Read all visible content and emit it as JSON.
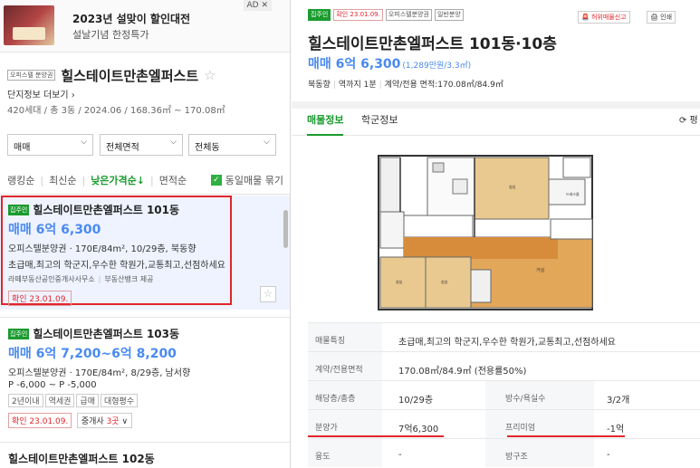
{
  "ad": {
    "badge": "AD ✕",
    "title": "2023년 설맞이 할인대전",
    "subtitle": "설날기념 한정특가"
  },
  "complex": {
    "type_tag": "오피스텔 분양권",
    "name": "힐스테이트만촌엘퍼스트",
    "more_link": "단지정보 더보기",
    "info": "420세대 / 총 3동 / 2024.06 / 168.36㎡ ~ 170.08㎡"
  },
  "filters": [
    {
      "label": "매매"
    },
    {
      "label": "전체면적"
    },
    {
      "label": "전체동"
    }
  ],
  "sort": {
    "items": [
      "랭킹순",
      "최신순",
      "낮은가격순↓",
      "면적순"
    ],
    "active_index": 2,
    "checkbox_label": "동일매물 묶기"
  },
  "listings": [
    {
      "tag": "집주인",
      "title": "힐스테이트만촌엘퍼스트 101동",
      "price": "매매 6억 6,300",
      "spec": "오피스텔분양권 · 170E/84m², 10/29층, 북동향",
      "desc": "초급매,최고의 학군지,우수한 학원가,교통최고,선점하세요",
      "source_agent": "라떼부동산공인중개사사무소",
      "source_provider": "부동산뱅크 제공",
      "confirm": "확인 23.01.09."
    },
    {
      "tag": "집주인",
      "title": "힐스테이트만촌엘퍼스트 103동",
      "price": "매매 6억 7,200~6억 8,200",
      "spec": "오피스텔분양권 · 170E/84m², 8/29층, 남서향",
      "premium": "P -6,000 ~ P -5,000",
      "chips": [
        "2년이내",
        "역세권",
        "급매",
        "대형평수"
      ],
      "confirm": "확인 23.01.09.",
      "broker_prefix": "중개사 ",
      "broker_count": "3곳",
      "broker_suffix": "∨"
    },
    {
      "title": "힐스테이트만촌엘퍼스트 102동"
    }
  ],
  "detail": {
    "tags": [
      "집주인",
      "확인 23.01.09.",
      "오피스텔분양권",
      "일반분양"
    ],
    "report": "허위매물신고",
    "print": "인쇄",
    "title": "힐스테이트만촌엘퍼스트 101동·10층",
    "price": "매매 6억 6,300",
    "price_per": "(1,289만원/3.3㎡)",
    "meta": [
      "북동향",
      "역까지 1분",
      "계약/전용 면적:170.08㎡/84.9㎡"
    ],
    "tabs": [
      "매물정보",
      "학군정보"
    ],
    "refresh": "⟳ 평",
    "table": [
      {
        "label": "매물특징",
        "value": "초급매,최고의 학군지,우수한 학원가,교통최고,선점하세요"
      },
      {
        "label": "계약/전용면적",
        "value": "170.08㎡/84.9㎡ (전용률50%)"
      },
      {
        "label": "해당층/총층",
        "value": "10/29층",
        "label2": "방수/욕실수",
        "value2": "3/2개"
      },
      {
        "label": "분양가",
        "value": "7억6,300",
        "label2": "프리미엄",
        "value2": "-1억"
      },
      {
        "label": "융도",
        "value": "-",
        "label2": "방구조",
        "value2": "-"
      }
    ]
  },
  "colors": {
    "green": "#1a9b2e",
    "blue_price": "#4a8af0",
    "red": "#e0262b"
  }
}
